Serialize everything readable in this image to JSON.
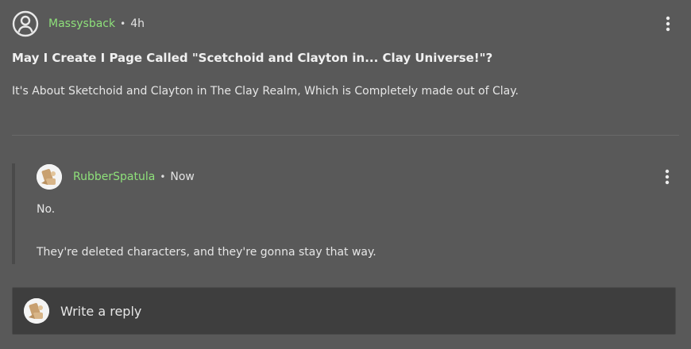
{
  "post": {
    "author": "Massysback",
    "separator": "•",
    "time": "4h",
    "title": "May I Create I Page Called \"Scetchoid and Clayton in... Clay Universe!\"?",
    "body": "It's About Sketchoid and Clayton in The Clay Realm, Which is Completely made out of Clay.",
    "avatar_icon": "user-circle-icon",
    "menu_icon": "more-vertical-icon"
  },
  "reply": {
    "author": "RubberSpatula",
    "separator": "•",
    "time": "Now",
    "lines": [
      "No.",
      "They're deleted characters, and they're gonna stay that way."
    ],
    "avatar_icon": "user-avatar-image",
    "menu_icon": "more-vertical-icon"
  },
  "reply_box": {
    "placeholder": "Write a reply",
    "avatar_icon": "user-avatar-image"
  },
  "colors": {
    "background": "#595959",
    "username": "#8ee07a",
    "reply_box_bg": "#3e3e3e"
  }
}
